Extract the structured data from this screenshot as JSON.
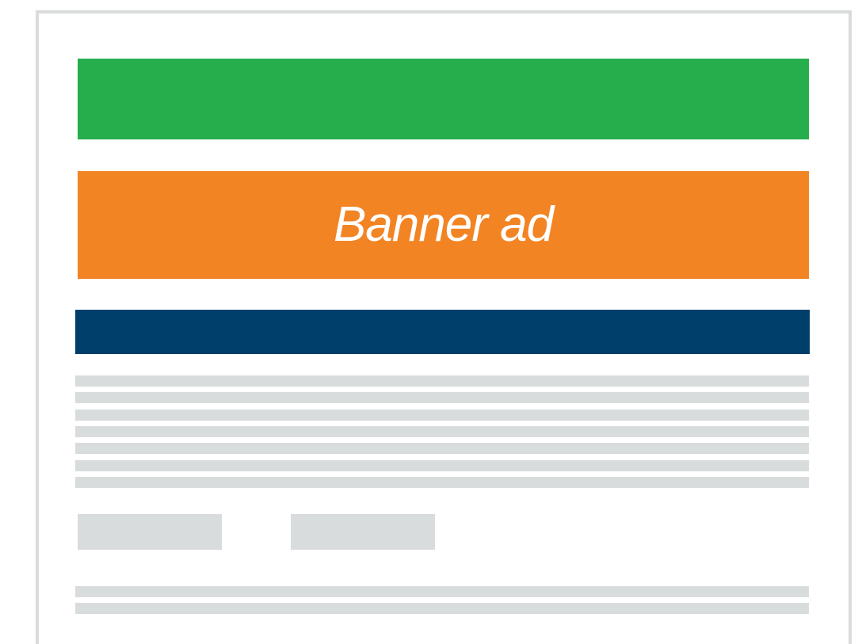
{
  "colors": {
    "frame": "#dadcdc",
    "header_bar": "#25ae4b",
    "banner_ad": "#f38424",
    "nav_bar": "#003f6b",
    "placeholder": "#d9dcdc"
  },
  "banner": {
    "label": "Banner ad"
  },
  "content_lines_group_1": 7,
  "placeholder_buttons": 2,
  "content_lines_group_2": 2
}
